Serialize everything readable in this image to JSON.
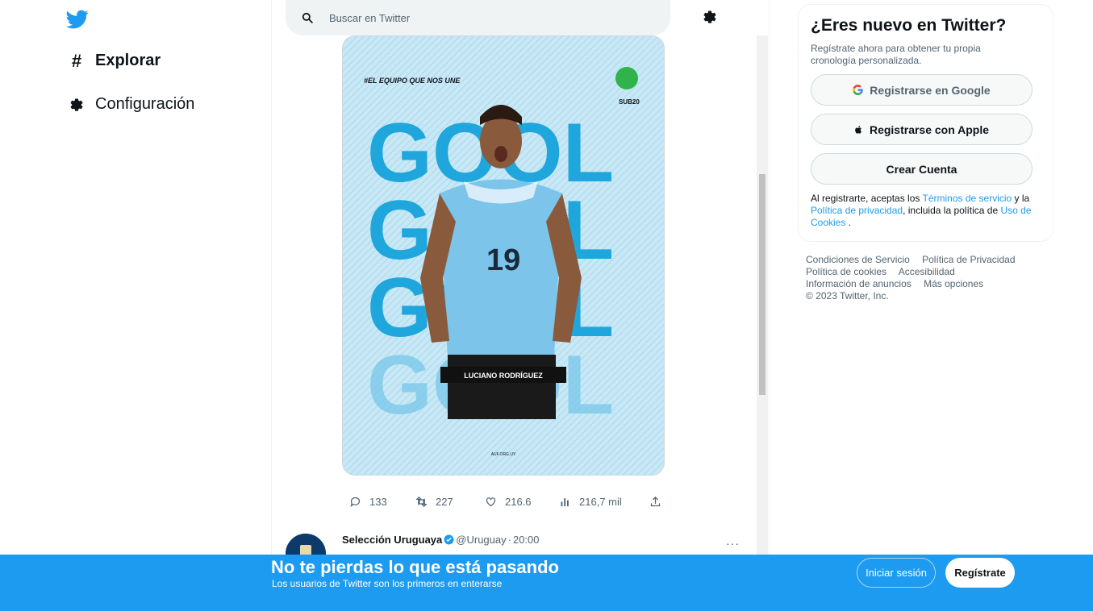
{
  "nav": {
    "logo": "twitter-bird-icon",
    "items": [
      {
        "label": "Explorar",
        "icon": "hashtag-icon"
      },
      {
        "label": "Configuración",
        "icon": "gear-icon"
      }
    ]
  },
  "search": {
    "placeholder": "Buscar en Twitter"
  },
  "media": {
    "hashtag": "#EL EQUIPO QUE NOS UNE",
    "big_word": "GOOL",
    "player_name": "LUCIANO RODRÍGUEZ",
    "jersey_number": "19",
    "badge_text": "SUB20",
    "footer_url": "AUF.ORG.UY"
  },
  "tweet_actions": {
    "replies": "133",
    "retweets": "227",
    "likes": "216.6",
    "views": "216,7 mil"
  },
  "next_tweet": {
    "name": "Selección Uruguaya",
    "handle": "@Uruguay",
    "separator": "·",
    "time": "20:00",
    "more": "···"
  },
  "signup": {
    "title": "¿Eres nuevo en Twitter?",
    "subtitle": "Regístrate ahora para obtener tu propia cronología personalizada.",
    "google_label": "Registrarse en Google",
    "apple_label": "Registrarse con Apple",
    "create_label": "Crear Cuenta",
    "legal_prefix": "Al registrarte, aceptas los ",
    "terms_link": "Términos de servicio",
    "legal_mid1": " y la ",
    "privacy_link": "Política de privacidad",
    "legal_mid2": ", incluida la política de ",
    "cookies_link": "Uso de Cookies",
    "legal_suffix": "."
  },
  "footer": {
    "links": [
      "Condiciones de Servicio",
      "Política de Privacidad",
      "Política de cookies",
      "Accesibilidad",
      "Información de anuncios",
      "Más opciones"
    ],
    "copyright": "© 2023 Twitter, Inc."
  },
  "banner": {
    "title": "No te pierdas lo que está pasando",
    "subtitle": "Los usuarios de Twitter son los primeros en enterarse",
    "login_label": "Iniciar sesión",
    "register_label": "Regístrate"
  },
  "colors": {
    "accent": "#1d9bf0",
    "text": "#0f1419",
    "muted": "#536471",
    "media_bg": "#bfe3f2",
    "gool": "#29a9dd"
  }
}
